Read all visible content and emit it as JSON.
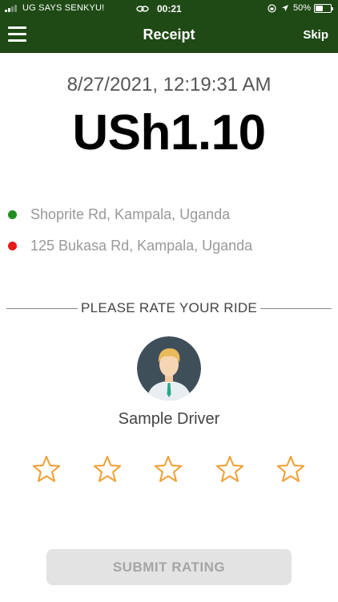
{
  "status_bar": {
    "carrier": "UG SAYS SENKYU!",
    "time": "00:21",
    "battery_percent": "50%",
    "battery_level": 0.5
  },
  "navbar": {
    "title": "Receipt",
    "skip_label": "Skip"
  },
  "receipt": {
    "datetime": "8/27/2021, 12:19:31 AM",
    "amount": "USh1.10"
  },
  "route": {
    "pickup": "Shoprite Rd, Kampala, Uganda",
    "dropoff": "125 Bukasa Rd, Kampala, Uganda"
  },
  "rating": {
    "heading": "PLEASE RATE YOUR RIDE",
    "driver_name": "Sample Driver",
    "stars_total": 5,
    "stars_selected": 0,
    "submit_label": "SUBMIT RATING"
  },
  "colors": {
    "header_bg": "#1f4a16",
    "pickup_dot": "#1e8f1e",
    "dropoff_dot": "#e51b1b",
    "star_outline": "#f0a23a",
    "submit_bg": "#e3e3e3",
    "submit_text": "#a5a5a5"
  },
  "icons": {
    "menu": "hamburger-menu-icon",
    "star": "star-outline-icon",
    "avatar": "driver-avatar-icon"
  }
}
